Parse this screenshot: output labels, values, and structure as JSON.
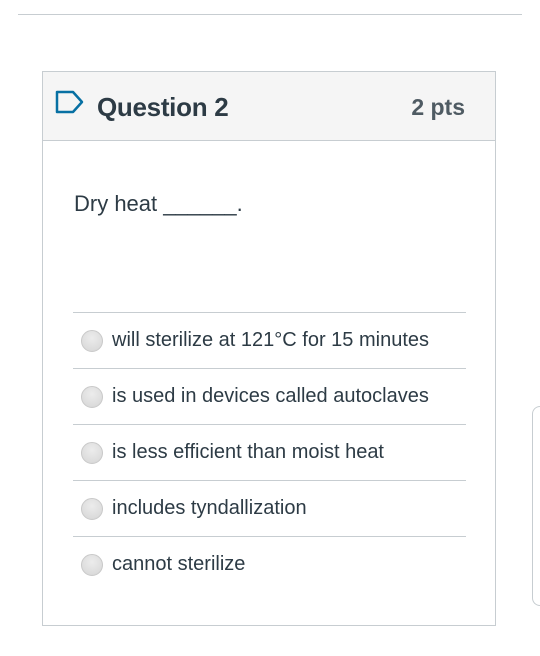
{
  "question": {
    "title": "Question 2",
    "points": "2 pts",
    "text": "Dry heat ______.",
    "flag_icon": "flag-outline-icon",
    "answers": [
      {
        "label": "will sterilize at 121°C for 15 minutes"
      },
      {
        "label": "is used in devices called autoclaves"
      },
      {
        "label": "is less efficient than moist heat"
      },
      {
        "label": "includes tyndallization"
      },
      {
        "label": "cannot sterilize"
      }
    ]
  },
  "colors": {
    "accent": "#0770a3",
    "text": "#2d3b45",
    "border": "#c7cdd1",
    "header_bg": "#f5f5f5"
  }
}
